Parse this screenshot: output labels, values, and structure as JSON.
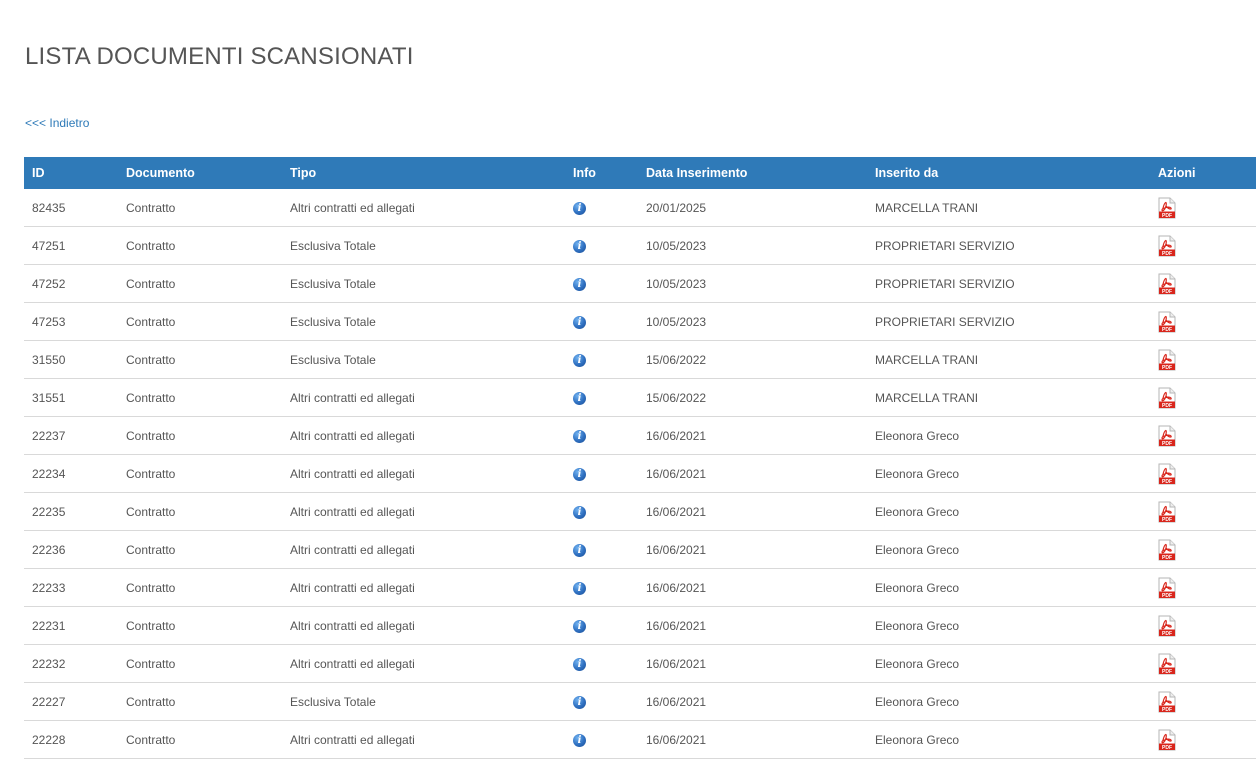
{
  "page": {
    "title": "LISTA DOCUMENTI SCANSIONATI",
    "back_link": "<<< Indietro"
  },
  "table": {
    "headers": {
      "id": "ID",
      "documento": "Documento",
      "tipo": "Tipo",
      "info": "Info",
      "data": "Data Inserimento",
      "inserito": "Inserito da",
      "azioni": "Azioni"
    },
    "rows": [
      {
        "id": "82435",
        "documento": "Contratto",
        "tipo": "Altri contratti ed allegati",
        "data": "20/01/2025",
        "inserito": "MARCELLA TRANI"
      },
      {
        "id": "47251",
        "documento": "Contratto",
        "tipo": "Esclusiva Totale",
        "data": "10/05/2023",
        "inserito": "PROPRIETARI SERVIZIO"
      },
      {
        "id": "47252",
        "documento": "Contratto",
        "tipo": "Esclusiva Totale",
        "data": "10/05/2023",
        "inserito": "PROPRIETARI SERVIZIO"
      },
      {
        "id": "47253",
        "documento": "Contratto",
        "tipo": "Esclusiva Totale",
        "data": "10/05/2023",
        "inserito": "PROPRIETARI SERVIZIO"
      },
      {
        "id": "31550",
        "documento": "Contratto",
        "tipo": "Esclusiva Totale",
        "data": "15/06/2022",
        "inserito": "MARCELLA TRANI"
      },
      {
        "id": "31551",
        "documento": "Contratto",
        "tipo": "Altri contratti ed allegati",
        "data": "15/06/2022",
        "inserito": "MARCELLA TRANI"
      },
      {
        "id": "22237",
        "documento": "Contratto",
        "tipo": "Altri contratti ed allegati",
        "data": "16/06/2021",
        "inserito": "Eleonora Greco"
      },
      {
        "id": "22234",
        "documento": "Contratto",
        "tipo": "Altri contratti ed allegati",
        "data": "16/06/2021",
        "inserito": "Eleonora Greco"
      },
      {
        "id": "22235",
        "documento": "Contratto",
        "tipo": "Altri contratti ed allegati",
        "data": "16/06/2021",
        "inserito": "Eleonora Greco"
      },
      {
        "id": "22236",
        "documento": "Contratto",
        "tipo": "Altri contratti ed allegati",
        "data": "16/06/2021",
        "inserito": "Eleonora Greco"
      },
      {
        "id": "22233",
        "documento": "Contratto",
        "tipo": "Altri contratti ed allegati",
        "data": "16/06/2021",
        "inserito": "Eleonora Greco"
      },
      {
        "id": "22231",
        "documento": "Contratto",
        "tipo": "Altri contratti ed allegati",
        "data": "16/06/2021",
        "inserito": "Eleonora Greco"
      },
      {
        "id": "22232",
        "documento": "Contratto",
        "tipo": "Altri contratti ed allegati",
        "data": "16/06/2021",
        "inserito": "Eleonora Greco"
      },
      {
        "id": "22227",
        "documento": "Contratto",
        "tipo": "Esclusiva Totale",
        "data": "16/06/2021",
        "inserito": "Eleonora Greco"
      },
      {
        "id": "22228",
        "documento": "Contratto",
        "tipo": "Altri contratti ed allegati",
        "data": "16/06/2021",
        "inserito": "Eleonora Greco"
      }
    ],
    "info_icon": "info-icon",
    "action_icon": "pdf-icon",
    "pdf_icon_label": "PDF"
  },
  "colors": {
    "header_bg": "#2f7ab8",
    "link": "#2e7ab8",
    "pdf_red": "#d9261c"
  }
}
